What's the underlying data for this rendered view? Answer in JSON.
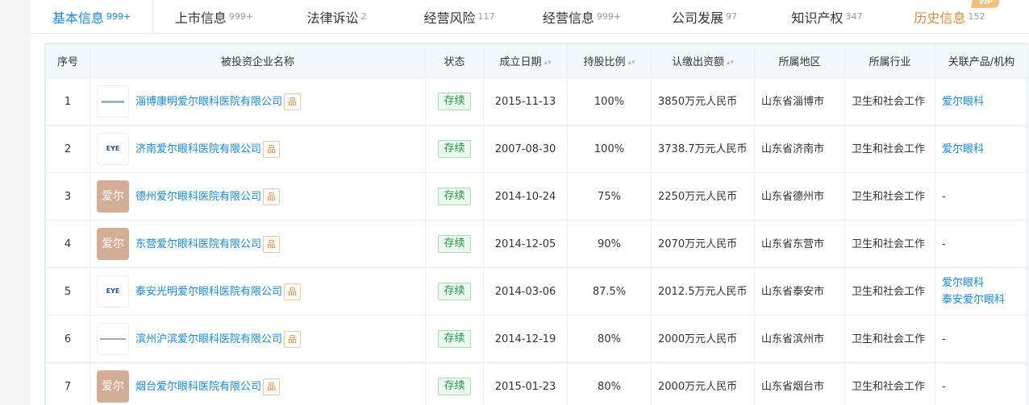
{
  "tabs": [
    {
      "label": "基本信息",
      "count": "999+",
      "active": true
    },
    {
      "label": "上市信息",
      "count": "999+"
    },
    {
      "label": "法律诉讼",
      "count": "2"
    },
    {
      "label": "经营风险",
      "count": "117"
    },
    {
      "label": "经营信息",
      "count": "999+"
    },
    {
      "label": "公司发展",
      "count": "97"
    },
    {
      "label": "知识产权",
      "count": "347"
    },
    {
      "label": "历史信息",
      "count": "152",
      "vip": "VIP"
    }
  ],
  "table": {
    "headers": [
      "序号",
      "被投资企业名称",
      "状态",
      "成立日期",
      "持股比例",
      "认缴出资额",
      "所属地区",
      "所属行业",
      "关联产品/机构"
    ],
    "tree_icon": "品",
    "rows": [
      {
        "no": "1",
        "name": "淄博康明爱尔眼科医院有限公司",
        "status": "存续",
        "date": "2015-11-13",
        "ratio": "100%",
        "capital": "3850万元人民币",
        "region": "山东省淄博市",
        "industry": "卫生和社会工作",
        "related": [
          "爱尔眼科"
        ],
        "logo": "bar"
      },
      {
        "no": "2",
        "name": "济南爱尔眼科医院有限公司",
        "status": "存续",
        "date": "2007-08-30",
        "ratio": "100%",
        "capital": "3738.7万元人民币",
        "region": "山东省济南市",
        "industry": "卫生和社会工作",
        "related": [
          "爱尔眼科"
        ],
        "logo": "eye",
        "logo_text": "EYE"
      },
      {
        "no": "3",
        "name": "德州爱尔眼科医院有限公司",
        "status": "存续",
        "date": "2014-10-24",
        "ratio": "75%",
        "capital": "2250万元人民币",
        "region": "山东省德州市",
        "industry": "卫生和社会工作",
        "related": [
          "-"
        ],
        "logo": "brown",
        "logo_text": "爱尔"
      },
      {
        "no": "4",
        "name": "东营爱尔眼科医院有限公司",
        "status": "存续",
        "date": "2014-12-05",
        "ratio": "90%",
        "capital": "2070万元人民币",
        "region": "山东省东营市",
        "industry": "卫生和社会工作",
        "related": [
          "-"
        ],
        "logo": "brown",
        "logo_text": "爱尔"
      },
      {
        "no": "5",
        "name": "泰安光明爱尔眼科医院有限公司",
        "status": "存续",
        "date": "2014-03-06",
        "ratio": "87.5%",
        "capital": "2012.5万元人民币",
        "region": "山东省泰安市",
        "industry": "卫生和社会工作",
        "related": [
          "爱尔眼科",
          "泰安爱尔眼科"
        ],
        "logo": "eye",
        "logo_text": "EYE"
      },
      {
        "no": "6",
        "name": "滨州沪滨爱尔眼科医院有限公司",
        "status": "存续",
        "date": "2014-12-19",
        "ratio": "80%",
        "capital": "2000万元人民币",
        "region": "山东省滨州市",
        "industry": "卫生和社会工作",
        "related": [
          "-"
        ],
        "logo": "bar2"
      },
      {
        "no": "7",
        "name": "烟台爱尔眼科医院有限公司",
        "status": "存续",
        "date": "2015-01-23",
        "ratio": "80%",
        "capital": "2000万元人民币",
        "region": "山东省烟台市",
        "industry": "卫生和社会工作",
        "related": [
          "-"
        ],
        "logo": "brown",
        "logo_text": "爱尔"
      }
    ]
  },
  "colors": {
    "accent": "#128bed",
    "status_green": "#1f9a42",
    "vip_orange": "#e08b3a"
  }
}
